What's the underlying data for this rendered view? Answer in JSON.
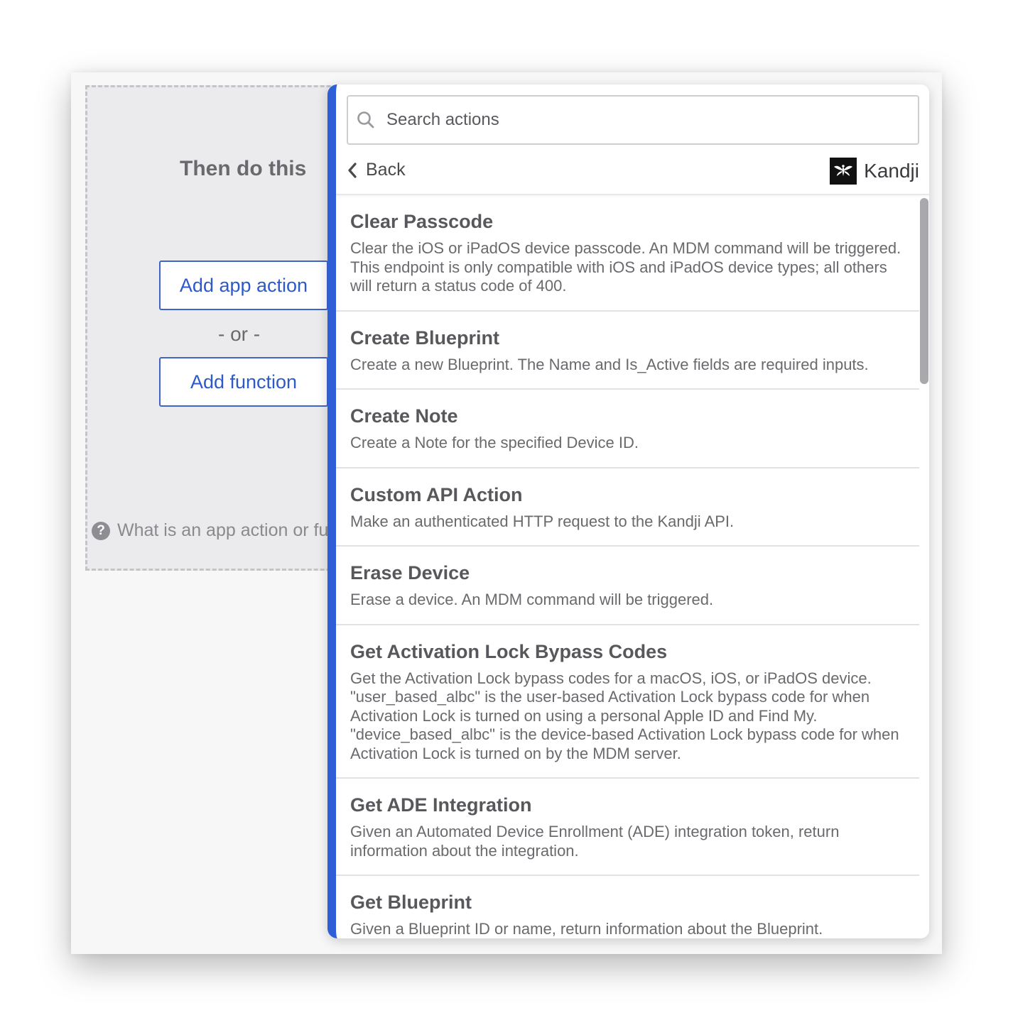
{
  "builder": {
    "section_title": "Then do this",
    "add_app_action_label": "Add app action",
    "or_label": "- or -",
    "add_function_label": "Add function",
    "help_text": "What is an app action or function?"
  },
  "panel": {
    "search_placeholder": "Search actions",
    "back_label": "Back",
    "app_name": "Kandji",
    "accent_color": "#2f5fd6",
    "actions": [
      {
        "title": "Clear Passcode",
        "description": "Clear the iOS or iPadOS device passcode. An MDM command will be triggered. This endpoint is only compatible with iOS and iPadOS device types; all others will return a status code of 400."
      },
      {
        "title": "Create Blueprint",
        "description": "Create a new Blueprint. The Name and Is_Active fields are required inputs."
      },
      {
        "title": "Create Note",
        "description": "Create a Note for the specified Device ID."
      },
      {
        "title": "Custom API Action",
        "description": "Make an authenticated HTTP request to the Kandji API."
      },
      {
        "title": "Erase Device",
        "description": "Erase a device. An MDM command will be triggered."
      },
      {
        "title": "Get Activation Lock Bypass Codes",
        "description": "Get the Activation Lock bypass codes for a macOS, iOS, or iPadOS device. \"user_based_albc\" is the user-based Activation Lock bypass code for when Activation Lock is turned on using a personal Apple ID and Find My. \"device_based_albc\" is the device-based Activation Lock bypass code for when Activation Lock is turned on by the MDM server."
      },
      {
        "title": "Get ADE Integration",
        "description": "Given an Automated Device Enrollment (ADE) integration token, return information about the integration."
      },
      {
        "title": "Get Blueprint",
        "description": "Given a Blueprint ID or name, return information about the Blueprint."
      }
    ]
  }
}
